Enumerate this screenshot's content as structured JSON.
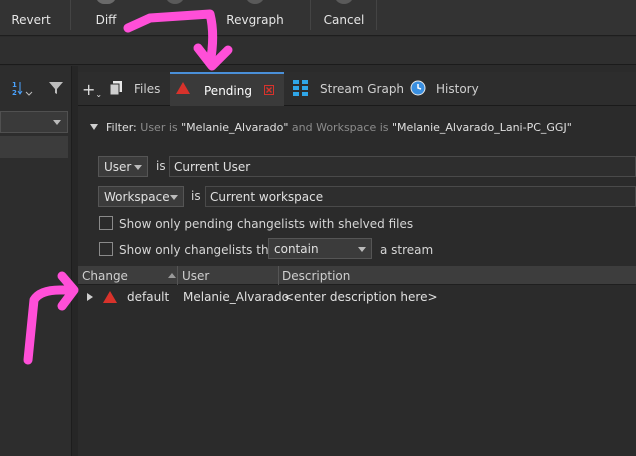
{
  "toolbar": {
    "buttons": [
      {
        "label": "Revert"
      },
      {
        "label": "Diff"
      },
      {
        "label": "Revgraph"
      },
      {
        "label": "Cancel"
      }
    ]
  },
  "tabs": [
    {
      "label": "Files",
      "icon": "files-icon"
    },
    {
      "label": "Pending",
      "icon": "pending-icon",
      "active": true
    },
    {
      "label": "Stream Graph",
      "icon": "stream-graph-icon"
    },
    {
      "label": "History",
      "icon": "history-icon"
    }
  ],
  "filter": {
    "label": "Filter:",
    "text_user_prefix": "User is ",
    "user_value": "\"Melanie_Alvarado\"",
    "text_and": " and Workspace is ",
    "workspace_value": "\"Melanie_Alvarado_Lani-PC_GGJ\"",
    "row1": {
      "field": "User",
      "op": "is",
      "value": "Current User"
    },
    "row2": {
      "field": "Workspace",
      "op": "is",
      "value": "Current workspace"
    },
    "shelved_label": "Show only pending changelists with shelved files",
    "stream_label_prefix": "Show only changelists that",
    "stream_select": "contain",
    "stream_label_suffix": "a stream"
  },
  "table": {
    "columns": [
      "Change",
      "User",
      "Description"
    ],
    "rows": [
      {
        "change": "default",
        "user": "Melanie_Alvarado",
        "description": "<enter description here>"
      }
    ]
  },
  "colors": {
    "accent": "#4a90d9",
    "pending_red": "#d8322b",
    "annotation_pink": "#ff4fd8"
  }
}
